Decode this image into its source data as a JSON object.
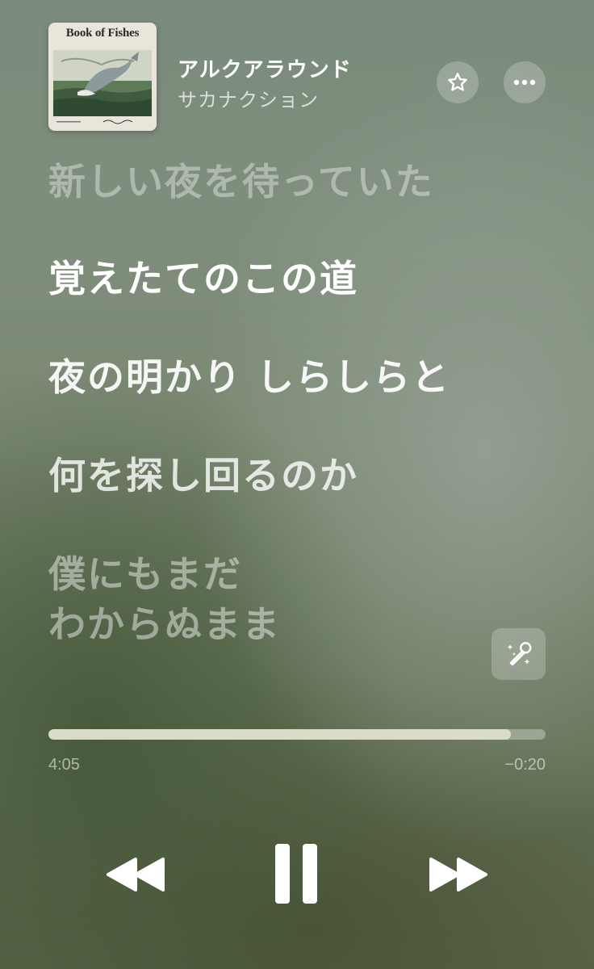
{
  "track": {
    "title": "アルクアラウンド",
    "artist": "サカナクション",
    "album_art_text": "Book of Fishes"
  },
  "header_buttons": [
    {
      "icon": "star-icon"
    },
    {
      "icon": "ellipsis-icon"
    }
  ],
  "lyrics": {
    "past": "新しい夜を待っていた",
    "active_1": "覚えたてのこの道",
    "active_2": "夜の明かり しらしらと",
    "next": "何を探し回るのか",
    "upcoming_1": "僕にもまだ",
    "upcoming_2": "わからぬまま"
  },
  "playback": {
    "elapsed": "4:05",
    "remaining": "−0:20",
    "progress_fraction": 0.93
  },
  "controls": [
    "rewind-icon",
    "pause-icon",
    "fast-forward-icon",
    "sing-mic-icon"
  ],
  "colors": {
    "progress_fill": "#d9dcc8",
    "text_primary": "#ffffff"
  }
}
